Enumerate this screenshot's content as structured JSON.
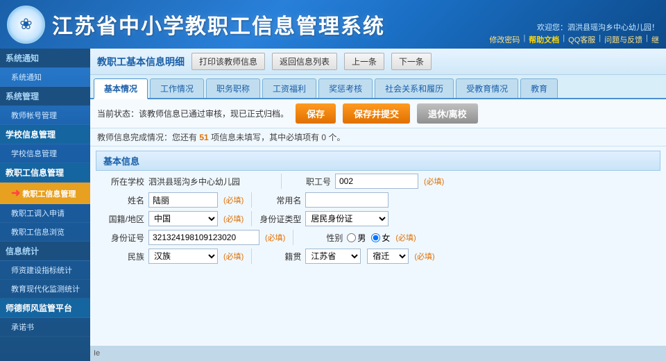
{
  "header": {
    "title": "江苏省中小学教职工信息管理系统",
    "welcome": "欢迎您：泗洪县瑶沟乡中心幼儿园！",
    "links": [
      "修改密码",
      "帮助文档",
      "QQ客服",
      "问题与反馈",
      "继"
    ]
  },
  "sidebar": {
    "sections": [
      {
        "title": "系统通知",
        "items": [
          {
            "label": "系统通知",
            "active": false,
            "sub": true
          }
        ]
      },
      {
        "title": "系统管理",
        "items": [
          {
            "label": "教师帐号管理",
            "active": false,
            "sub": true
          }
        ]
      },
      {
        "title": "学校信息管理",
        "items": [
          {
            "label": "学校信息管理",
            "active": false,
            "sub": true
          }
        ]
      },
      {
        "title": "教职工信息管理",
        "items": [
          {
            "label": "教职工信息管理",
            "active": true,
            "sub": true
          },
          {
            "label": "教职工调入申请",
            "active": false,
            "sub": true
          },
          {
            "label": "教职工信息浏览",
            "active": false,
            "sub": true
          }
        ]
      },
      {
        "title": "信息统计",
        "items": [
          {
            "label": "师资建设指标统计",
            "active": false,
            "sub": true
          },
          {
            "label": "教育现代化监测统计",
            "active": false,
            "sub": true
          }
        ]
      },
      {
        "title": "师德师风监管平台",
        "items": [
          {
            "label": "承诺书",
            "active": false,
            "sub": true
          }
        ]
      }
    ]
  },
  "content_header": {
    "title": "教职工基本信息明细",
    "buttons": [
      "打印该教师信息",
      "返回信息列表",
      "上一条",
      "下一条"
    ]
  },
  "tabs": [
    {
      "label": "基本情况",
      "active": true
    },
    {
      "label": "工作情况",
      "active": false
    },
    {
      "label": "职务职称",
      "active": false
    },
    {
      "label": "工资福利",
      "active": false
    },
    {
      "label": "奖惩考核",
      "active": false
    },
    {
      "label": "社会关系和履历",
      "active": false
    },
    {
      "label": "受教育情况",
      "active": false
    },
    {
      "label": "教育",
      "active": false
    }
  ],
  "status": {
    "text": "当前状态：该教师信息已通过审核，现已正式归档。",
    "buttons": {
      "save": "保存",
      "save_submit": "保存并提交",
      "retire": "退休/离校"
    }
  },
  "info_bar": {
    "prefix": "教师信息完成情况：您还有",
    "count": "51",
    "suffix": "项信息未填写，其中必填项有",
    "required_count": "0",
    "end": "个。"
  },
  "section_basic": "基本信息",
  "form": {
    "school_label": "所在学校",
    "school_value": "泗洪县瑶沟乡中心幼儿园",
    "employee_id_label": "职工号",
    "employee_id_value": "002",
    "employee_id_note": "(必填)",
    "name_label": "姓名",
    "name_value": "陆丽",
    "name_note": "(必填)",
    "usual_name_label": "常用名",
    "usual_name_value": "",
    "nationality_label": "国籍/地区",
    "nationality_value": "中国",
    "nationality_note": "(必填)",
    "id_type_label": "身份证类型",
    "id_type_value": "居民身份证",
    "id_number_label": "身份证号",
    "id_number_value": "321324198109123020",
    "id_number_note": "(必填)",
    "gender_label": "性别",
    "gender_male": "男",
    "gender_female": "女",
    "gender_note": "(必填)",
    "ethnicity_label": "民族",
    "ethnicity_value": "汉族",
    "ethnicity_note": "(必填)",
    "native_place_label": "籍贯",
    "native_place_value": "江苏省",
    "native_place_note": "(必填)"
  },
  "bottom_bar": {
    "text": "Ie"
  }
}
